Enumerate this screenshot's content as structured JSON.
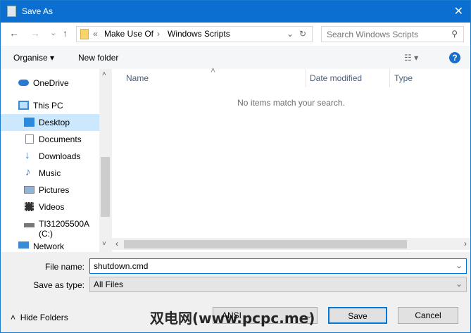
{
  "window": {
    "title": "Save As",
    "close": "✕"
  },
  "nav": {
    "back": "←",
    "forward": "→",
    "recent": "⌄",
    "up": "↑",
    "crumb_overflow": "«",
    "crumbs": [
      "Make Use Of",
      "Windows Scripts"
    ],
    "refresh": "↻",
    "search_placeholder": "Search Windows Scripts"
  },
  "toolbar": {
    "organise": "Organise ▾",
    "new_folder": "New folder",
    "view": "☷ ▾",
    "help": "?"
  },
  "sidebar": {
    "items": [
      {
        "label": "OneDrive",
        "icon": "cloud"
      },
      {
        "label": "This PC",
        "icon": "computer"
      },
      {
        "label": "Desktop",
        "icon": "desktop",
        "selected": true
      },
      {
        "label": "Documents",
        "icon": "document"
      },
      {
        "label": "Downloads",
        "icon": "download-arrow"
      },
      {
        "label": "Music",
        "icon": "music-note"
      },
      {
        "label": "Pictures",
        "icon": "picture"
      },
      {
        "label": "Videos",
        "icon": "film"
      },
      {
        "label": "TI31205500A (C:)",
        "icon": "drive"
      },
      {
        "label": "Network",
        "icon": "network"
      }
    ]
  },
  "columns": [
    "Name",
    "Date modified",
    "Type"
  ],
  "empty_message": "No items match your search.",
  "form": {
    "file_name_label": "File name:",
    "file_name_value": "shutdown.cmd",
    "save_type_label": "Save as type:",
    "save_type_value": "All Files"
  },
  "footer": {
    "hide_folders": "Hide Folders",
    "encoding_value": "ANSI",
    "save": "Save",
    "cancel": "Cancel"
  },
  "watermark": "双电网(www.pcpc.me)"
}
